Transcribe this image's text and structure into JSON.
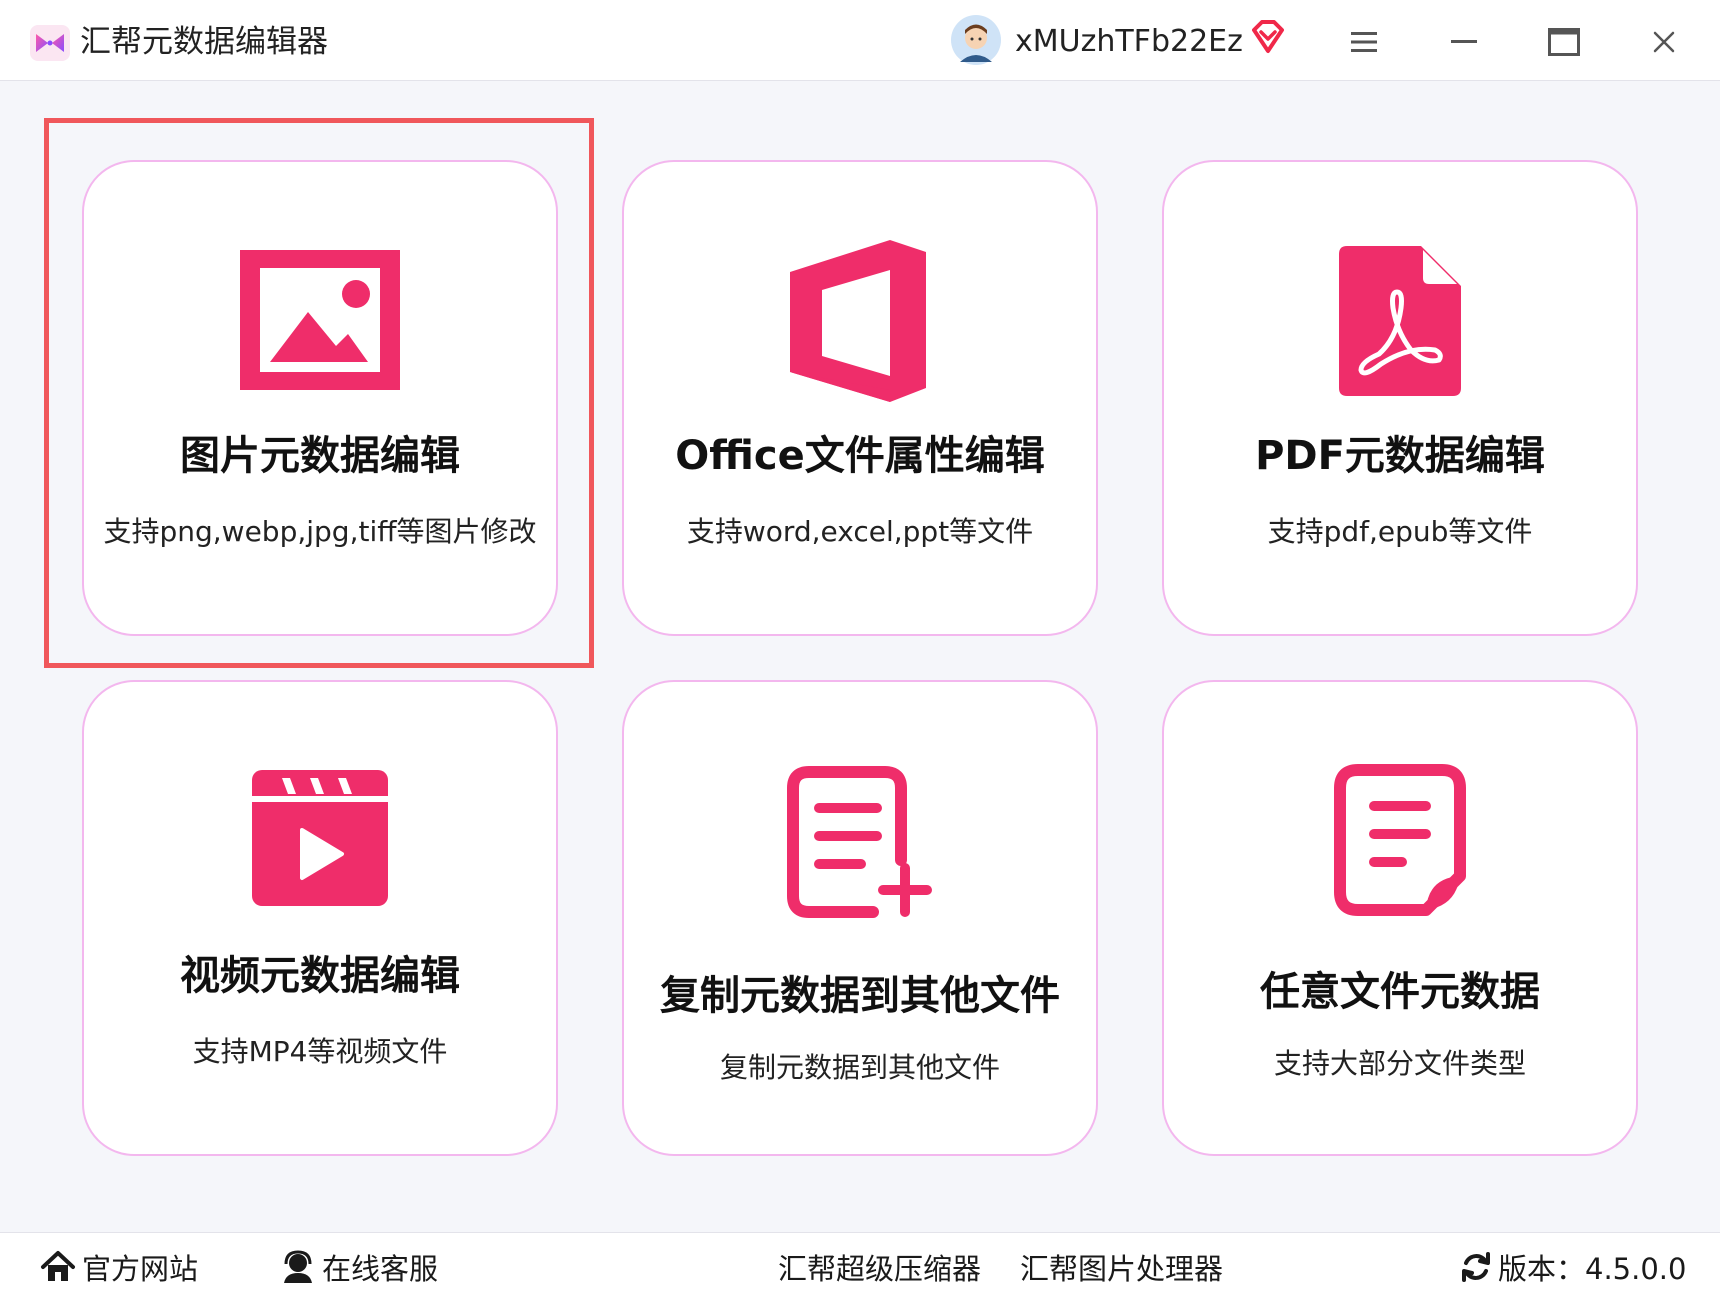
{
  "titlebar": {
    "app_title": "汇帮元数据编辑器",
    "username": "xMUzhTFb22Ez",
    "icons": {
      "logo": "butterfly-logo-icon",
      "avatar": "user-avatar-icon",
      "vip": "vip-diamond-icon",
      "menu": "hamburger-menu-icon",
      "minimize": "minimize-icon",
      "maximize": "maximize-icon",
      "close": "close-icon"
    }
  },
  "cards": [
    {
      "title": "图片元数据编辑",
      "subtitle": "支持png,webp,jpg,tiff等图片修改",
      "icon": "image-icon"
    },
    {
      "title": "Office文件属性编辑",
      "subtitle": "支持word,excel,ppt等文件",
      "icon": "office-icon"
    },
    {
      "title": "PDF元数据编辑",
      "subtitle": "支持pdf,epub等文件",
      "icon": "pdf-icon"
    },
    {
      "title": "视频元数据编辑",
      "subtitle": "支持MP4等视频文件",
      "icon": "video-icon"
    },
    {
      "title": "复制元数据到其他文件",
      "subtitle": "复制元数据到其他文件",
      "icon": "document-add-icon"
    },
    {
      "title": "任意文件元数据",
      "subtitle": "支持大部分文件类型",
      "icon": "document-icon"
    }
  ],
  "footer": {
    "website": "官方网站",
    "support": "在线客服",
    "compressor": "汇帮超级压缩器",
    "image_processor": "汇帮图片处理器",
    "version": "版本：4.5.0.0"
  },
  "colors": {
    "accent": "#ef2d6a",
    "card_border": "#f3b7ee",
    "highlight": "#f0575b",
    "background": "#f5f6fa"
  }
}
